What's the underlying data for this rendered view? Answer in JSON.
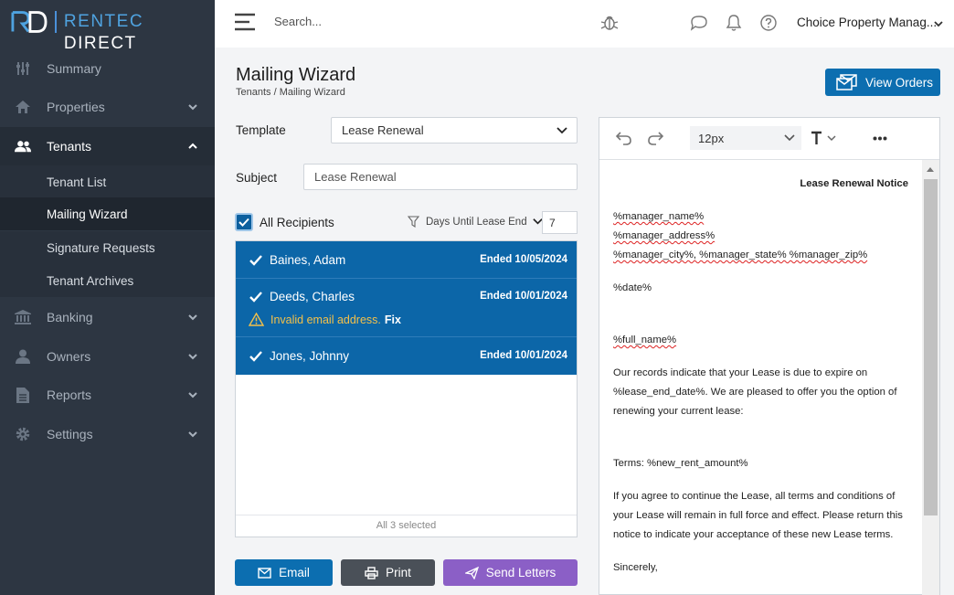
{
  "brand": {
    "name_a": "RENTEC",
    "name_b": "DIRECT"
  },
  "sidebar": {
    "items": [
      {
        "label": "Summary",
        "icon": "sliders-icon"
      },
      {
        "label": "Properties",
        "icon": "home-icon"
      },
      {
        "label": "Tenants",
        "icon": "users-icon"
      },
      {
        "label": "Banking",
        "icon": "bank-icon"
      },
      {
        "label": "Owners",
        "icon": "user-icon"
      },
      {
        "label": "Reports",
        "icon": "file-icon"
      },
      {
        "label": "Settings",
        "icon": "gear-icon"
      }
    ],
    "tenant_sub": [
      "Tenant List",
      "Mailing Wizard",
      "Signature Requests",
      "Tenant Archives"
    ]
  },
  "topbar": {
    "search_placeholder": "Search...",
    "company": "Choice Property Manag..."
  },
  "page": {
    "title": "Mailing Wizard",
    "breadcrumb": "Tenants / Mailing Wizard",
    "view_orders": "View Orders"
  },
  "form": {
    "template_label": "Template",
    "template_value": "Lease Renewal",
    "subject_label": "Subject",
    "subject_value": "Lease Renewal",
    "all_recipients": "All Recipients",
    "filter_label": "Days Until Lease End",
    "days_value": "7"
  },
  "recipients": [
    {
      "name": "Baines, Adam",
      "ended": "Ended 10/05/2024"
    },
    {
      "name": "Deeds, Charles",
      "ended": "Ended 10/01/2024",
      "warning": "Invalid email address.",
      "fix": "Fix"
    },
    {
      "name": "Jones, Johnny",
      "ended": "Ended 10/01/2024"
    }
  ],
  "list_footer": "All 3 selected",
  "actions": {
    "email": "Email",
    "print": "Print",
    "send": "Send Letters"
  },
  "colors": {
    "primary": "#0c6eb0",
    "print": "#4a5058",
    "send": "#8b5fc6",
    "sidebar": "#2d3642",
    "warning": "#f3c04a"
  },
  "editor": {
    "font_size": "12px",
    "notice_title": "Lease Renewal Notice",
    "lines": [
      "%manager_name%",
      "%manager_address%",
      "%manager_city%, %manager_state%  %manager_zip%",
      "%date%",
      "%full_name%",
      "Our records indicate that your Lease is due to expire on",
      "%lease_end_date%. We are pleased to offer you the option of",
      "renewing your current lease:",
      "Terms: %new_rent_amount%",
      "If you agree to continue the Lease, all terms and conditions of",
      "your Lease will remain in full force and effect. Please return this",
      "notice to indicate your acceptance of these new Lease terms.",
      "Sincerely,"
    ]
  }
}
